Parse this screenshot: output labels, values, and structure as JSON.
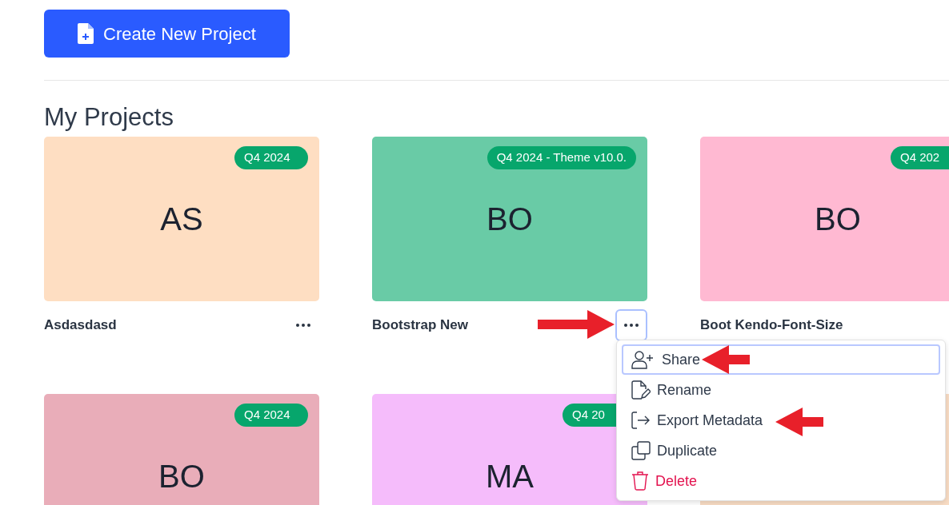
{
  "create_button": {
    "label": "Create New Project"
  },
  "section_title": "My Projects",
  "projects": [
    {
      "initials": "AS",
      "badge": "Q4 2024",
      "name": "Asdasdasd",
      "color": "#fedec2",
      "menu_open": false
    },
    {
      "initials": "BO",
      "badge": "Q4 2024 - Theme v10.0.",
      "name": "Bootstrap New",
      "color": "#69cba6",
      "menu_open": true
    },
    {
      "initials": "BO",
      "badge": "Q4 202",
      "name": "Boot Kendo-Font-Size",
      "color": "#ffb9d2"
    },
    {
      "initials": "BO",
      "badge": "Q4 2024",
      "color": "#e9adb9"
    },
    {
      "initials": "MA",
      "badge": "Q4 20",
      "color": "#f5bcfb"
    },
    {
      "color": "#f8dcc4"
    }
  ],
  "menu": {
    "items": [
      {
        "kind": "share",
        "label": "Share",
        "selected": true
      },
      {
        "kind": "rename",
        "label": "Rename",
        "selected": false
      },
      {
        "kind": "export",
        "label": "Export Metadata",
        "selected": false
      },
      {
        "kind": "duplicate",
        "label": "Duplicate",
        "selected": false
      },
      {
        "kind": "delete",
        "label": "Delete",
        "selected": false
      }
    ]
  },
  "annotations": [
    {
      "kind": "arrow",
      "color": "#e8202a"
    },
    {
      "kind": "arrow",
      "color": "#e8202a"
    },
    {
      "kind": "arrow",
      "color": "#e8202a"
    }
  ]
}
